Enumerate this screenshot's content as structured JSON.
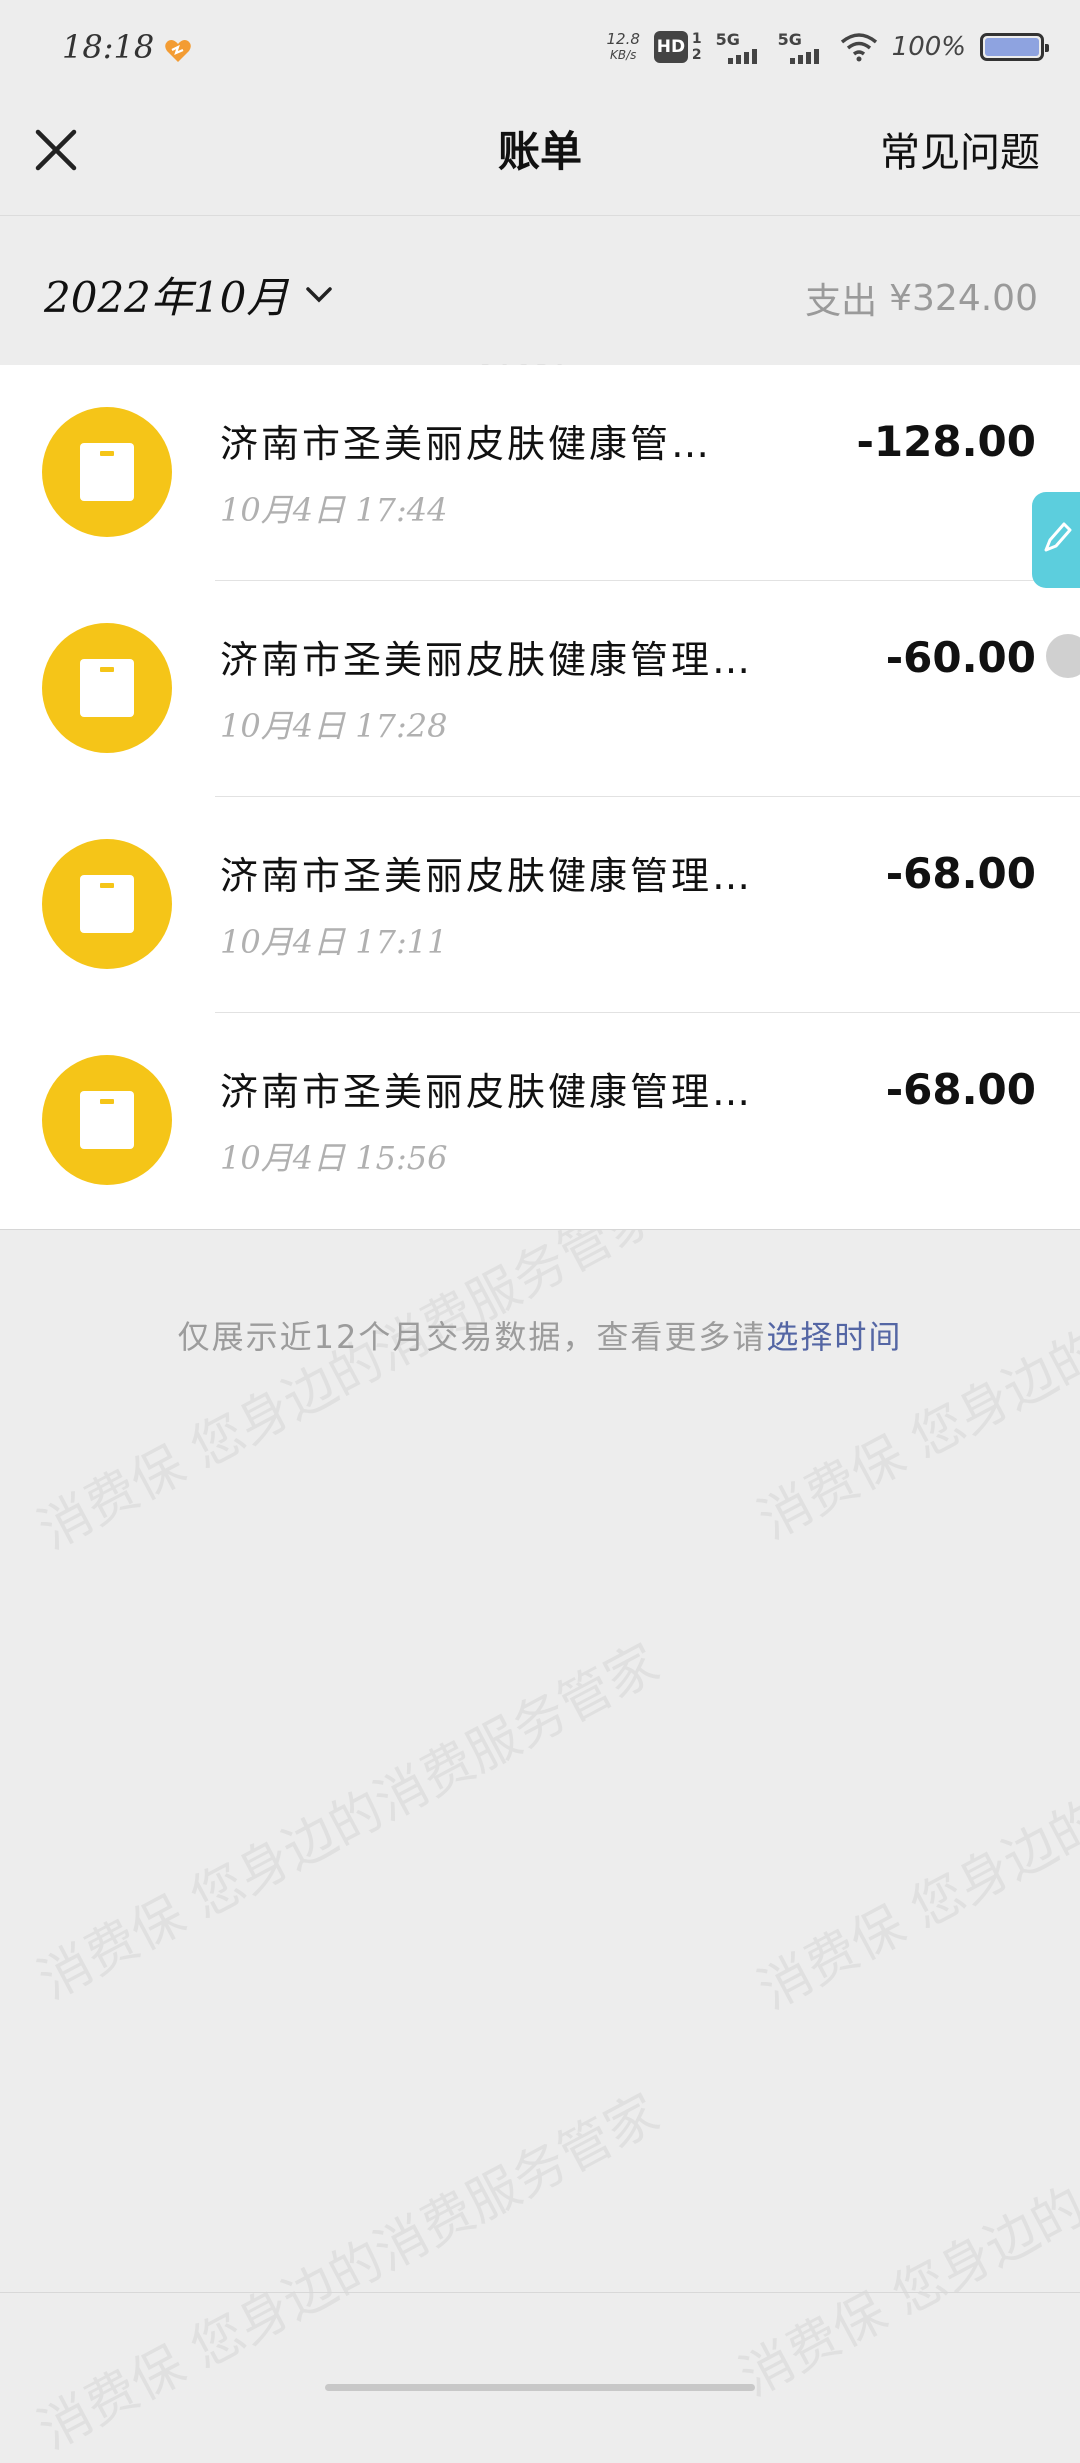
{
  "status_bar": {
    "time": "18:18",
    "net_speed": "12.8",
    "net_speed_unit": "KB/s",
    "hd": "HD",
    "sim_label_1": "1",
    "sim_label_2": "2",
    "signal_1": "5G",
    "signal_2": "5G",
    "battery_pct": "100%"
  },
  "nav": {
    "close_icon": "close-icon",
    "title": "账单",
    "faq": "常见问题"
  },
  "month": {
    "label": "2022年10月",
    "total_label": "支出",
    "total_value": "¥324.00"
  },
  "transactions": [
    {
      "merchant": "济南市圣美丽皮肤健康管…",
      "time": "10月4日 17:44",
      "amount": "-128.00"
    },
    {
      "merchant": "济南市圣美丽皮肤健康管理…",
      "time": "10月4日 17:28",
      "amount": "-60.00"
    },
    {
      "merchant": "济南市圣美丽皮肤健康管理…",
      "time": "10月4日 17:11",
      "amount": "-68.00"
    },
    {
      "merchant": "济南市圣美丽皮肤健康管理…",
      "time": "10月4日 15:56",
      "amount": "-68.00"
    }
  ],
  "footer": {
    "note": "仅展示近12个月交易数据，查看更多请",
    "link": "选择时间"
  },
  "watermark": {
    "text_a": "消费保 您身边的消费服务管家",
    "text_b": "消费保 您身边的"
  },
  "colors": {
    "avatar": "#f5c518",
    "link": "#5466a4",
    "float_tab": "#5ccedd",
    "battery": "#8ea3e0"
  }
}
